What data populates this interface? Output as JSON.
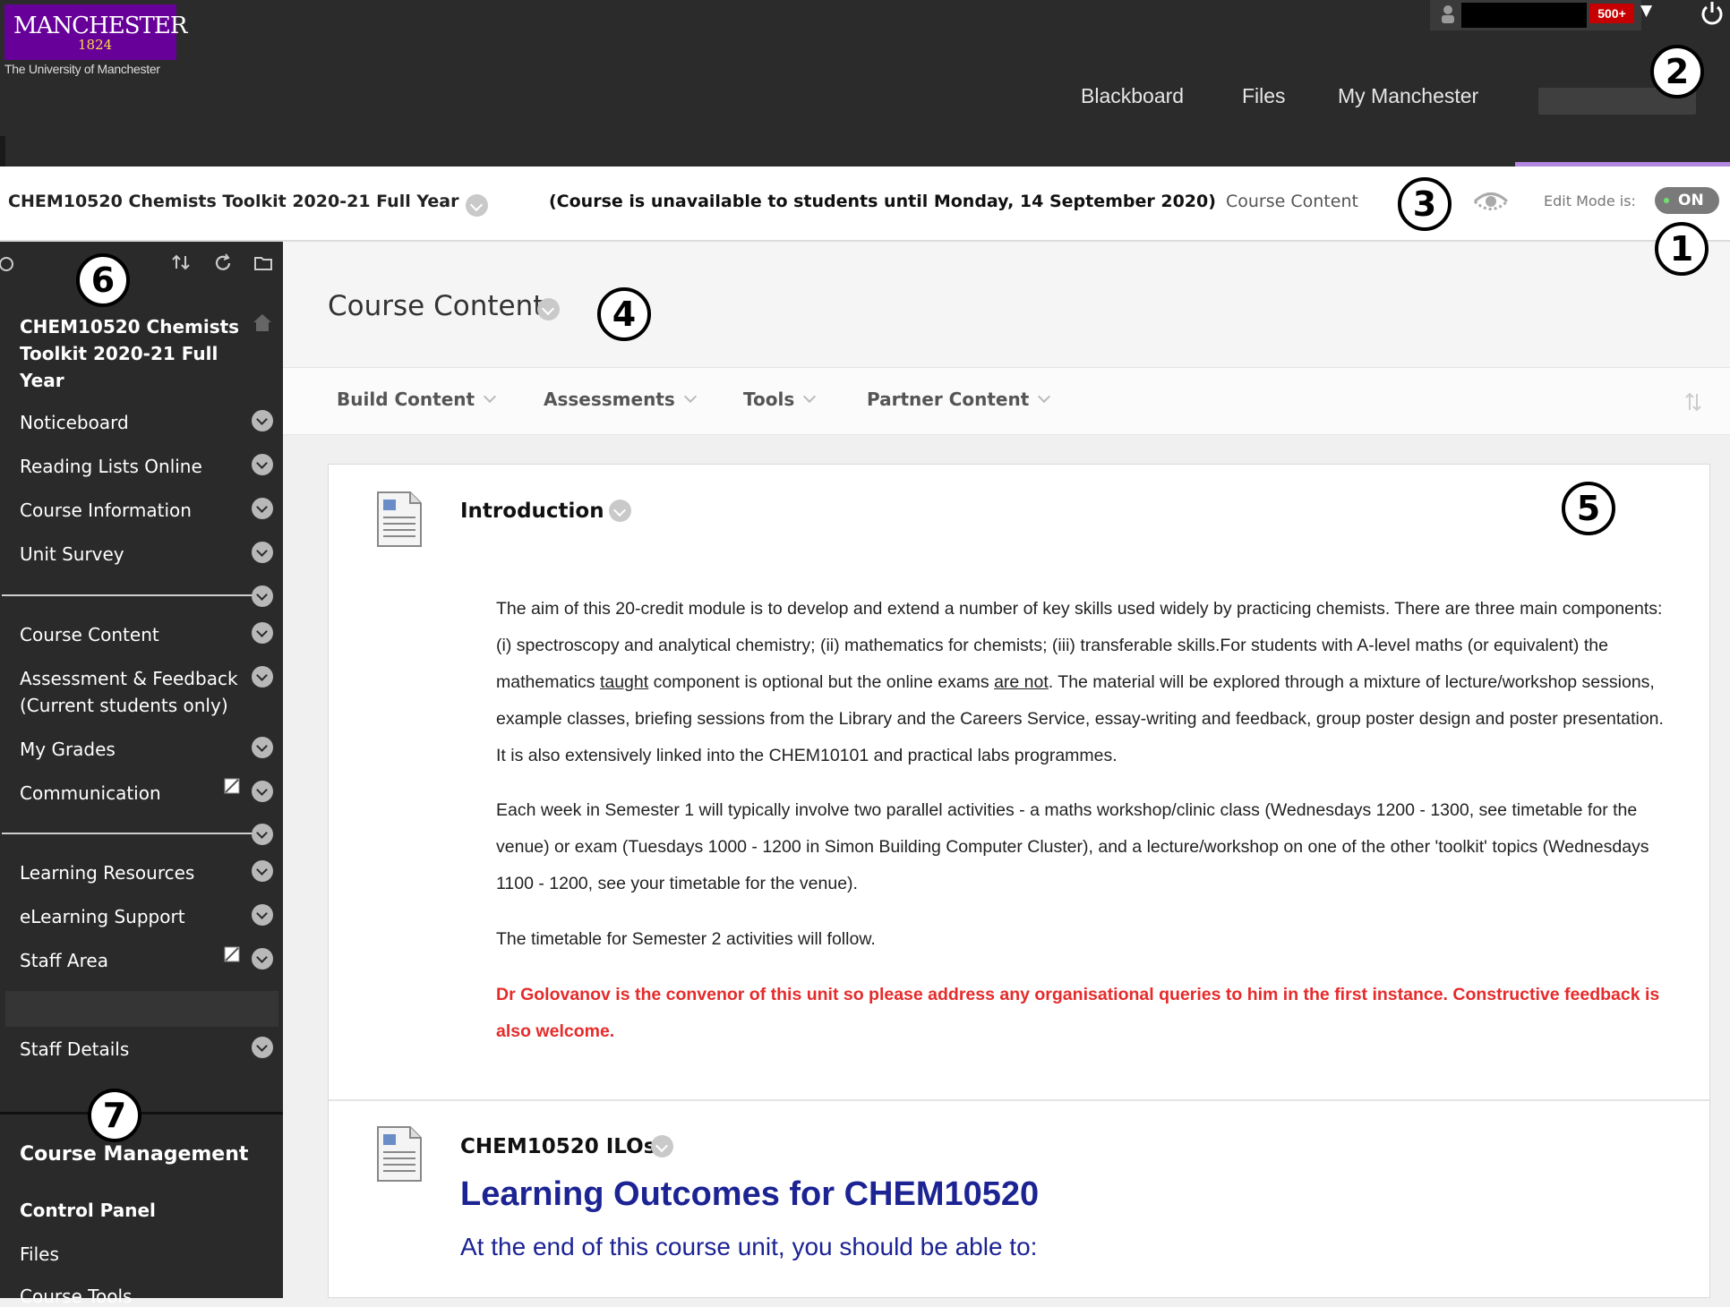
{
  "header": {
    "logo_name": "MANCHESTER",
    "logo_year": "1824",
    "logo_subtitle": "The University of Manchester",
    "notification_count": "500+",
    "nav": [
      "Blackboard",
      "Files",
      "My Manchester"
    ]
  },
  "annotations": [
    "1",
    "2",
    "3",
    "4",
    "5",
    "6",
    "7"
  ],
  "breadcrumb": {
    "course": "CHEM10520 Chemists Toolkit 2020-21 Full Year",
    "availability": "(Course is unavailable to students until Monday, 14 September 2020)",
    "current": "Course Content",
    "edit_mode_label": "Edit Mode is:",
    "edit_mode_value": "ON"
  },
  "sidebar": {
    "course_title": "CHEM10520 Chemists Toolkit 2020-21 Full Year",
    "items": [
      "Noticeboard",
      "Reading Lists Online",
      "Course Information",
      "Unit Survey",
      "Course Content",
      "Assessment & Feedback (Current students only)",
      "My Grades",
      "Communication",
      "Learning Resources",
      "eLearning Support",
      "Staff Area",
      "Staff Details"
    ],
    "management_title": "Course Management",
    "control_panel": "Control Panel",
    "files": "Files",
    "course_tools": "Course Tools"
  },
  "main": {
    "title": "Course Content",
    "actions": [
      "Build Content",
      "Assessments",
      "Tools",
      "Partner Content"
    ],
    "intro": {
      "title": "Introduction",
      "p1_a": "The aim of this 20-credit module is to develop and extend a number of key skills used widely by practicing chemists. There are three main components: (i) spectroscopy and analytical chemistry; (ii) mathematics for chemists; (iii) transferable skills.For students with A-level maths (or equivalent) the mathematics ",
      "p1_taught": "taught",
      "p1_b": " component is optional but the online exams ",
      "p1_arenot": "are not",
      "p1_c": ". The material will be explored through a mixture of lecture/workshop sessions, example classes, briefing sessions from the Library and the Careers Service, essay-writing and feedback, group poster design and poster presentation. It is also extensively linked into the CHEM10101 and practical labs programmes.",
      "p2": "Each week in Semester 1 will typically involve two parallel activities - a maths workshop/clinic class (Wednesdays 1200 - 1300, see timetable for the venue)   or exam (Tuesdays 1000 - 1200 in Simon Building Computer Cluster), and a lecture/workshop on one of the other 'toolkit' topics (Wednesdays 1100 - 1200, see your timetable for the venue).",
      "p3": "The timetable for Semester 2 activities will follow.",
      "p4": "Dr Golovanov is the convenor of this unit so please address any organisational queries to him in the first instance. Constructive feedback is also welcome."
    },
    "ilos": {
      "title": "CHEM10520 ILOs",
      "heading": "Learning Outcomes for CHEM10520",
      "subheading": "At the end of this course unit, you should be able to:"
    }
  },
  "colors": {
    "brand_purple": "#660099",
    "accent_red": "#e62b2b",
    "link_blue": "#1c2393"
  },
  "icons": [
    "user-icon",
    "logout-icon",
    "eye-icon",
    "sort-icon",
    "refresh-icon",
    "folder-icon",
    "home-icon",
    "chevron-down-icon",
    "document-icon",
    "hidden-from-students-icon"
  ]
}
